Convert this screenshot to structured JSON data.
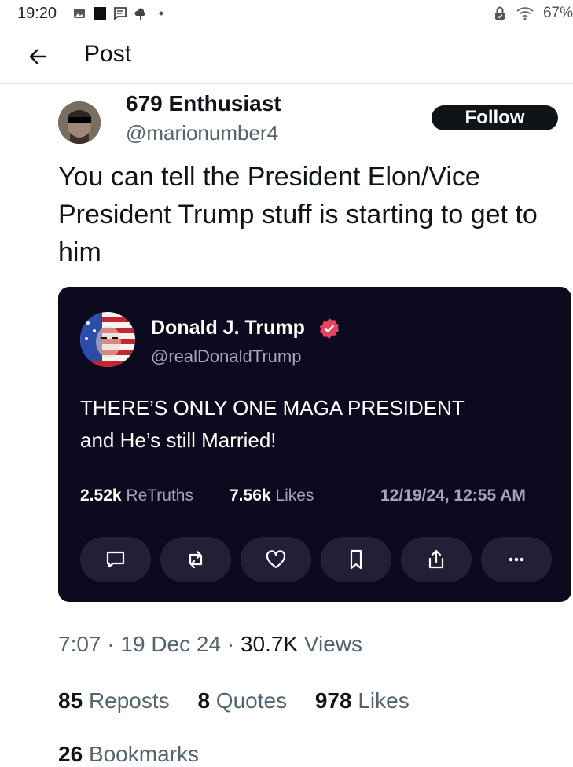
{
  "status_bar": {
    "time": "19:20",
    "battery": "67%",
    "icons": [
      "gallery-icon",
      "square-icon",
      "message-icon",
      "cloud-icon",
      "dot-icon",
      "lock-icon",
      "wifi-icon"
    ]
  },
  "header": {
    "title": "Post",
    "back_icon": "arrow-left-icon"
  },
  "post": {
    "author_name": "679 Enthusiast",
    "author_handle": "@marionumber4",
    "follow_label": "Follow",
    "text": "You can tell the President Elon/Vice President Trump stuff is starting to get to him",
    "embedded": {
      "name": "Donald J. Trump",
      "handle": "@realDonaldTrump",
      "verified": true,
      "text_line1": "THERE’S ONLY ONE MAGA PRESIDENT",
      "text_line2": "and He’s still Married!",
      "retruths_count": "2.52k",
      "retruths_label": "ReTruths",
      "likes_count": "7.56k",
      "likes_label": "Likes",
      "date": "12/19/24, 12:55 AM",
      "actions": [
        "comment-icon",
        "retruth-icon",
        "heart-icon",
        "bookmark-icon",
        "share-icon",
        "more-icon"
      ]
    },
    "time": "7:07",
    "date": "19 Dec 24",
    "views_count": "30.7K",
    "views_label": "Views",
    "reposts_count": "85",
    "reposts_label": "Reposts",
    "quotes_count": "8",
    "quotes_label": "Quotes",
    "likes_count": "978",
    "likes_label": "Likes",
    "bookmarks_count": "26",
    "bookmarks_label": "Bookmarks"
  },
  "colors": {
    "card_bg": "#0c0a1e",
    "action_bg": "#221f37",
    "verified": "#e8455d",
    "muted": "#536471"
  }
}
